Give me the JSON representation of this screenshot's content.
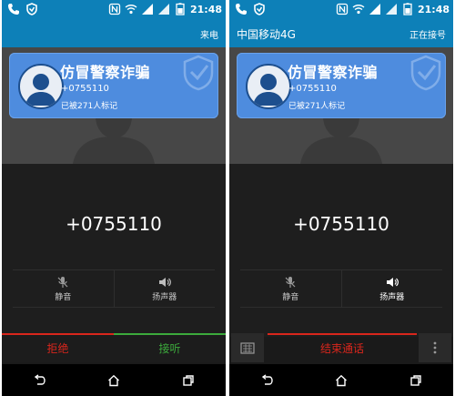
{
  "status": {
    "time": "21:48"
  },
  "screens": [
    {
      "header_right": "来电",
      "caller": {
        "name": "仿冒警察诈骗",
        "number": "+0755110",
        "marked": "已被271人标记"
      },
      "big_number": "+0755110",
      "audio": {
        "mute": "静音",
        "speaker": "扬声器"
      },
      "actions": {
        "reject": "拒绝",
        "accept": "接听"
      }
    },
    {
      "header_left": "中国移动4G",
      "header_right": "正在接号",
      "caller": {
        "name": "仿冒警察诈骗",
        "number": "+0755110",
        "marked": "已被271人标记"
      },
      "big_number": "+0755110",
      "audio": {
        "mute": "静音",
        "speaker": "扬声器"
      },
      "actions": {
        "end": "结束通话"
      }
    }
  ],
  "colors": {
    "statusbar": "#0d80b8",
    "card": "#4e8cde",
    "reject": "#d9261c",
    "accept": "#3caa3c"
  }
}
